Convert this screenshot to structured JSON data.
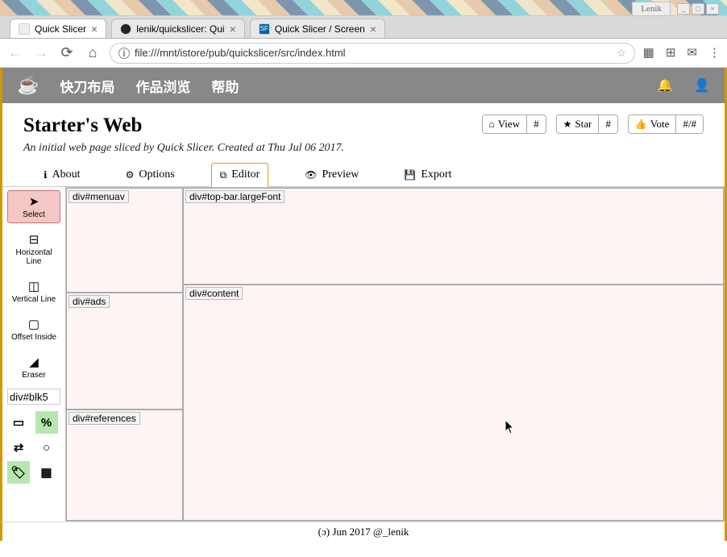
{
  "window": {
    "user_label": "Lenik"
  },
  "browser": {
    "tabs": [
      {
        "title": "Quick Slicer",
        "active": true
      },
      {
        "title": "lenik/quickslicer: Qui"
      },
      {
        "title": "Quick Slicer / Screen"
      }
    ],
    "url": "file:///mnt/istore/pub/quickslicer/src/index.html"
  },
  "app": {
    "menu": [
      "快刀布局",
      "作品浏览",
      "帮助"
    ]
  },
  "project": {
    "title": "Starter's Web",
    "subtitle": "An initial web page sliced by Quick Slicer. Created at Thu Jul 06 2017."
  },
  "action_buttons": {
    "view": "View",
    "view_count": "#",
    "star": "Star",
    "star_count": "#",
    "vote": "Vote",
    "vote_count": "#/#"
  },
  "main_tabs": {
    "about": "About",
    "options": "Options",
    "editor": "Editor",
    "preview": "Preview",
    "export": "Export"
  },
  "toolbox": {
    "select": "Select",
    "horz": "Horizontal Line",
    "vert": "Vertical Line",
    "offset": "Offset Inside",
    "eraser": "Eraser",
    "label_value": "div#blk5",
    "percent": "%",
    "px": "▭"
  },
  "blocks": {
    "menuav": "div#menuav",
    "topbar": "div#top-bar.largeFont",
    "ads": "div#ads",
    "content": "div#content",
    "refs": "div#references"
  },
  "footer": "(ɔ) Jun 2017 @_lenik"
}
